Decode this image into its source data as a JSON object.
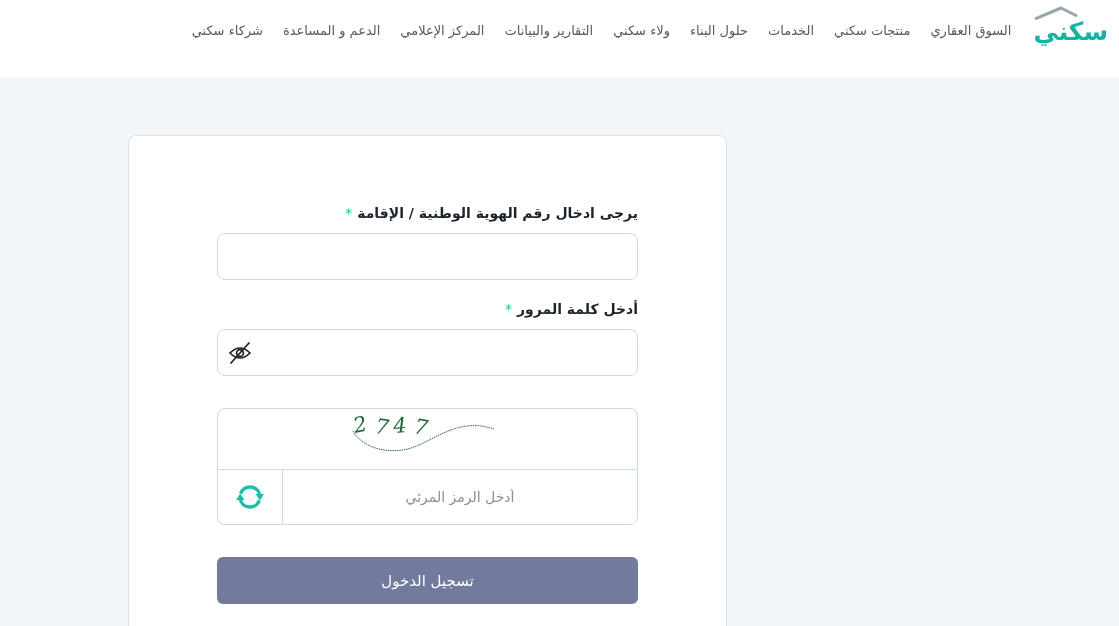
{
  "header": {
    "logo": {
      "text": "سكني"
    },
    "nav": [
      {
        "label": "السوق العقاري"
      },
      {
        "label": "منتجات سكني"
      },
      {
        "label": "الخدمات"
      },
      {
        "label": "حلول البناء"
      },
      {
        "label": "ولاء سكني"
      },
      {
        "label": "التقارير والبيانات"
      },
      {
        "label": "المركز الإعلامي"
      },
      {
        "label": "الدعم و المساعدة"
      },
      {
        "label": "شركاء سكني"
      }
    ]
  },
  "login_form": {
    "id_field": {
      "label": "يرجى ادخال رقم الهوية الوطنية / الإقامة",
      "required_mark": "*"
    },
    "password_field": {
      "label": "أدخل كلمة المرور",
      "required_mark": "*"
    },
    "captcha": {
      "code": "2747",
      "placeholder": "أدخل الرمز المرئي"
    },
    "submit_button": {
      "label": "تسجيل الدخول"
    }
  }
}
